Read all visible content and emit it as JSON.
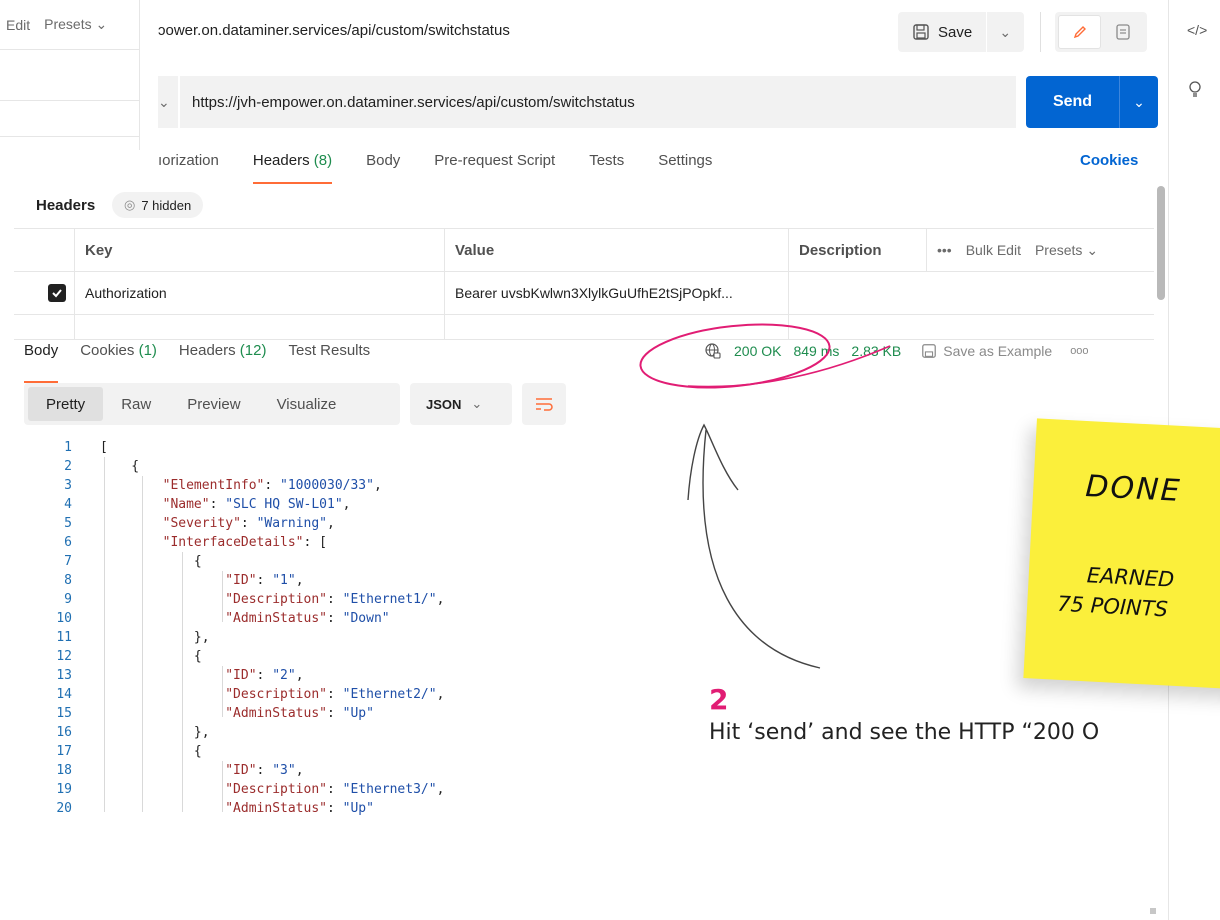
{
  "left_panel": {
    "edit_label": "Edit",
    "presets_label": "Presets"
  },
  "header": {
    "request_title": "ɔower.on.dataminer.services/api/custom/switchstatus",
    "save_label": "Save"
  },
  "request": {
    "url": "https://jvh-empower.on.dataminer.services/api/custom/switchstatus",
    "send_label": "Send"
  },
  "request_tabs": [
    {
      "label": "ıorization",
      "count": ""
    },
    {
      "label": "Headers",
      "count": "(8)"
    },
    {
      "label": "Body",
      "count": ""
    },
    {
      "label": "Pre-request Script",
      "count": ""
    },
    {
      "label": "Tests",
      "count": ""
    },
    {
      "label": "Settings",
      "count": ""
    }
  ],
  "cookies_link": "Cookies",
  "headers_section": {
    "title": "Headers",
    "hidden_label": "7 hidden",
    "columns": {
      "key": "Key",
      "value": "Value",
      "description": "Description"
    },
    "more_label": "•••",
    "bulk_edit_label": "Bulk Edit",
    "presets_label": "Presets",
    "rows": [
      {
        "key": "Authorization",
        "value": "Bearer uvsbKwlwn3XlylkGuUfhE2tSjPOpkf...",
        "description": "",
        "checked": true
      }
    ]
  },
  "response": {
    "tabs": [
      {
        "label": "Body",
        "count": ""
      },
      {
        "label": "Cookies",
        "count": "(1)"
      },
      {
        "label": "Headers",
        "count": "(12)"
      },
      {
        "label": "Test Results",
        "count": ""
      }
    ],
    "status": "200 OK",
    "time": "849 ms",
    "size": "2.83 KB",
    "save_example_label": "Save as Example",
    "more_label": "ooo",
    "format_buttons": [
      "Pretty",
      "Raw",
      "Preview",
      "Visualize"
    ],
    "format_selected": "Pretty",
    "language": "JSON"
  },
  "code_lines": [
    {
      "n": "1",
      "t": "["
    },
    {
      "n": "2",
      "t": "    {"
    },
    {
      "n": "3",
      "t": "        \"ElementInfo\": \"1000030/33\","
    },
    {
      "n": "4",
      "t": "        \"Name\": \"SLC HQ SW-L01\","
    },
    {
      "n": "5",
      "t": "        \"Severity\": \"Warning\","
    },
    {
      "n": "6",
      "t": "        \"InterfaceDetails\": ["
    },
    {
      "n": "7",
      "t": "            {"
    },
    {
      "n": "8",
      "t": "                \"ID\": \"1\","
    },
    {
      "n": "9",
      "t": "                \"Description\": \"Ethernet1/\","
    },
    {
      "n": "10",
      "t": "                \"AdminStatus\": \"Down\""
    },
    {
      "n": "11",
      "t": "            },"
    },
    {
      "n": "12",
      "t": "            {"
    },
    {
      "n": "13",
      "t": "                \"ID\": \"2\","
    },
    {
      "n": "14",
      "t": "                \"Description\": \"Ethernet2/\","
    },
    {
      "n": "15",
      "t": "                \"AdminStatus\": \"Up\""
    },
    {
      "n": "16",
      "t": "            },"
    },
    {
      "n": "17",
      "t": "            {"
    },
    {
      "n": "18",
      "t": "                \"ID\": \"3\","
    },
    {
      "n": "19",
      "t": "                \"Description\": \"Ethernet3/\","
    },
    {
      "n": "20",
      "t": "                \"AdminStatus\": \"Up\""
    }
  ],
  "annotation": {
    "step": "2",
    "text": "Hit ‘send’ and see the HTTP “200 O"
  },
  "sticky_note": {
    "title": "DONE",
    "line1": "EARNED",
    "line2": "75 POINTS"
  },
  "colors": {
    "accent": "#ff6c37",
    "send_blue": "#0265d2",
    "ok_green": "#1e8c4e",
    "annotation_pink": "#e11d74",
    "sticky_yellow": "#fbef3b"
  }
}
